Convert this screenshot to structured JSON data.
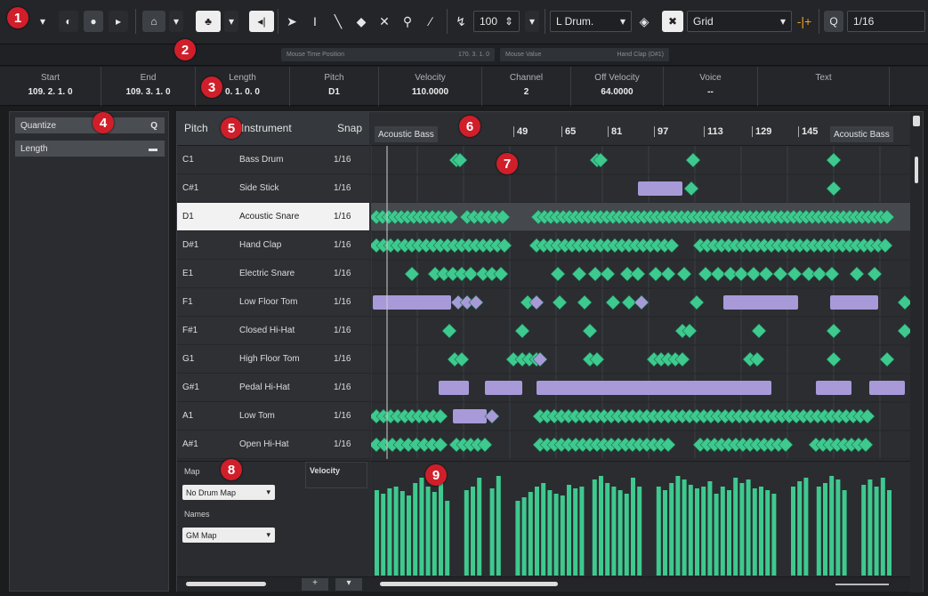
{
  "toolbar": {
    "quantize_value": "1/16",
    "grid_mode": "Grid",
    "zoom_value": "100",
    "drum_label": "L Drum.",
    "tools": [
      "object-selection",
      "range-selection",
      "draw",
      "erase",
      "mute",
      "zoom",
      "line"
    ]
  },
  "status": {
    "mouse_time_label": "Mouse Time Position",
    "mouse_time_value": "170. 3. 1. 0",
    "mouse_value_label": "Mouse Value",
    "mouse_value_value": "Hand Clap (D#1)"
  },
  "infoline": [
    {
      "label": "Start",
      "value": "109. 2. 1.   0"
    },
    {
      "label": "End",
      "value": "109. 3. 1.   0"
    },
    {
      "label": "Length",
      "value": "0. 1. 0.   0"
    },
    {
      "label": "Pitch",
      "value": "D1"
    },
    {
      "label": "Velocity",
      "value": "110.0000"
    },
    {
      "label": "Channel",
      "value": "2"
    },
    {
      "label": "Off Velocity",
      "value": "64.0000"
    },
    {
      "label": "Voice",
      "value": "--"
    },
    {
      "label": "Text",
      "value": ""
    }
  ],
  "inspector": {
    "sections": [
      "Quantize",
      "Length"
    ]
  },
  "drumlist": {
    "headers": {
      "pitch": "Pitch",
      "instrument": "Instrument",
      "snap": "Snap"
    },
    "rows": [
      {
        "pitch": "C1",
        "instrument": "Bass Drum",
        "snap": "1/16"
      },
      {
        "pitch": "C#1",
        "instrument": "Side Stick",
        "snap": "1/16"
      },
      {
        "pitch": "D1",
        "instrument": "Acoustic Snare",
        "snap": "1/16"
      },
      {
        "pitch": "D#1",
        "instrument": "Hand Clap",
        "snap": "1/16"
      },
      {
        "pitch": "E1",
        "instrument": "Electric Snare",
        "snap": "1/16"
      },
      {
        "pitch": "F1",
        "instrument": "Low Floor Tom",
        "snap": "1/16"
      },
      {
        "pitch": "F#1",
        "instrument": "Closed Hi-Hat",
        "snap": "1/16"
      },
      {
        "pitch": "G1",
        "instrument": "High Floor Tom",
        "snap": "1/16"
      },
      {
        "pitch": "G#1",
        "instrument": "Pedal Hi-Hat",
        "snap": "1/16"
      },
      {
        "pitch": "A1",
        "instrument": "Low Tom",
        "snap": "1/16"
      },
      {
        "pitch": "A#1",
        "instrument": "Open Hi-Hat",
        "snap": "1/16"
      }
    ]
  },
  "ruler": {
    "event_label_left": "Acoustic Bass",
    "event_label_right": "Acoustic Bass",
    "bars": [
      "49",
      "65",
      "81",
      "97",
      "113",
      "129",
      "145"
    ]
  },
  "lanes": {
    "map_label": "Map",
    "map_value": "No Drum Map",
    "names_label": "Names",
    "names_value": "GM Map",
    "velocity_label": "Velocity"
  },
  "callouts": [
    "1",
    "2",
    "3",
    "4",
    "5",
    "6",
    "7",
    "8",
    "9"
  ],
  "colors": {
    "note_green": "#3ec98f",
    "note_purple": "#a89ad8",
    "callout_red": "#d01f2a",
    "selected_row": "#f2f2f2"
  }
}
